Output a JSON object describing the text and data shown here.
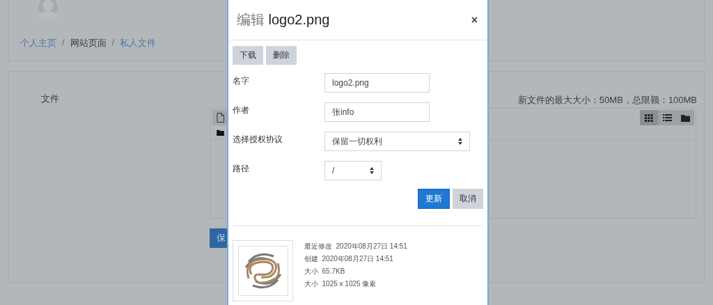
{
  "page": {
    "breadcrumb": [
      {
        "label": "个人主页",
        "kind": "link"
      },
      {
        "label": "/",
        "kind": "separator"
      },
      {
        "label": "网站页面",
        "kind": "text"
      },
      {
        "label": "/",
        "kind": "separator"
      },
      {
        "label": "私人文件",
        "kind": "link"
      }
    ],
    "files_label": "文件",
    "limits": "新文件的最大大小：50MB，总限额：100MB",
    "toolbar": [
      {
        "kind": "file",
        "selected": true
      }
    ],
    "view_modes": [
      {
        "kind": "grid",
        "selected": true
      },
      {
        "kind": "list",
        "selected": false
      },
      {
        "kind": "folder",
        "selected": false
      }
    ],
    "save_button": "保"
  },
  "dialog": {
    "title": {
      "action": "编辑",
      "filename": "logo2.png"
    },
    "close": "×",
    "actions": [
      "下载",
      "删除"
    ],
    "fields": [
      {
        "label": "名字",
        "kind": "text",
        "value": "logo2.png"
      },
      {
        "label": "作者",
        "kind": "text",
        "value": "张info"
      },
      {
        "label": "选择授权协议",
        "kind": "select",
        "value": "保留一切权利"
      },
      {
        "label": "路径",
        "kind": "select-small",
        "value": "/"
      }
    ],
    "buttons": [
      {
        "label": "更新",
        "kind": "primary"
      },
      {
        "label": "取消",
        "kind": "secondary"
      }
    ],
    "info": [
      {
        "label": "最近修改",
        "value": "2020年08月27日 14:51"
      },
      {
        "label": "创建",
        "value": "2020年08月27日 14:51"
      },
      {
        "label": "大小",
        "value": "65.7KB"
      },
      {
        "label": "大小",
        "value": "1025 x 1025 像素"
      }
    ]
  }
}
